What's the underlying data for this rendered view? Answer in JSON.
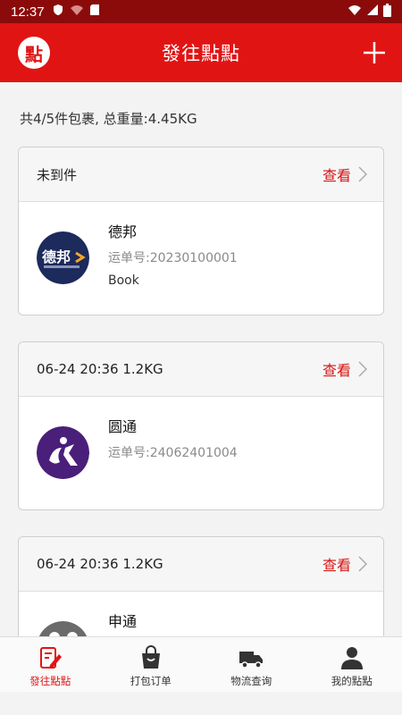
{
  "status_bar": {
    "time": "12:37"
  },
  "header": {
    "logo_char": "點",
    "title": "發往點點"
  },
  "summary": "共4/5件包裹, 总重量:4.45KG",
  "cards": [
    {
      "header": "未到件",
      "view_label": "查看",
      "carrier": "德邦",
      "waybill": "运单号:20230100001",
      "description": "Book",
      "logo_text": "德邦"
    },
    {
      "header": "06-24 20:36 1.2KG",
      "view_label": "查看",
      "carrier": "圆通",
      "waybill": "运单号:24062401004",
      "description": ""
    },
    {
      "header": "06-24 20:36 1.2KG",
      "view_label": "查看",
      "carrier": "申通",
      "waybill": "",
      "description": ""
    }
  ],
  "tabs": [
    {
      "label": "發往點點",
      "icon": "edit-icon",
      "active": true
    },
    {
      "label": "打包订单",
      "icon": "bag-icon",
      "active": false
    },
    {
      "label": "物流查询",
      "icon": "truck-icon",
      "active": false
    },
    {
      "label": "我的點點",
      "icon": "user-icon",
      "active": false
    }
  ],
  "colors": {
    "primary": "#e11414",
    "status_bar": "#8b0b0b",
    "link": "#d81414"
  }
}
